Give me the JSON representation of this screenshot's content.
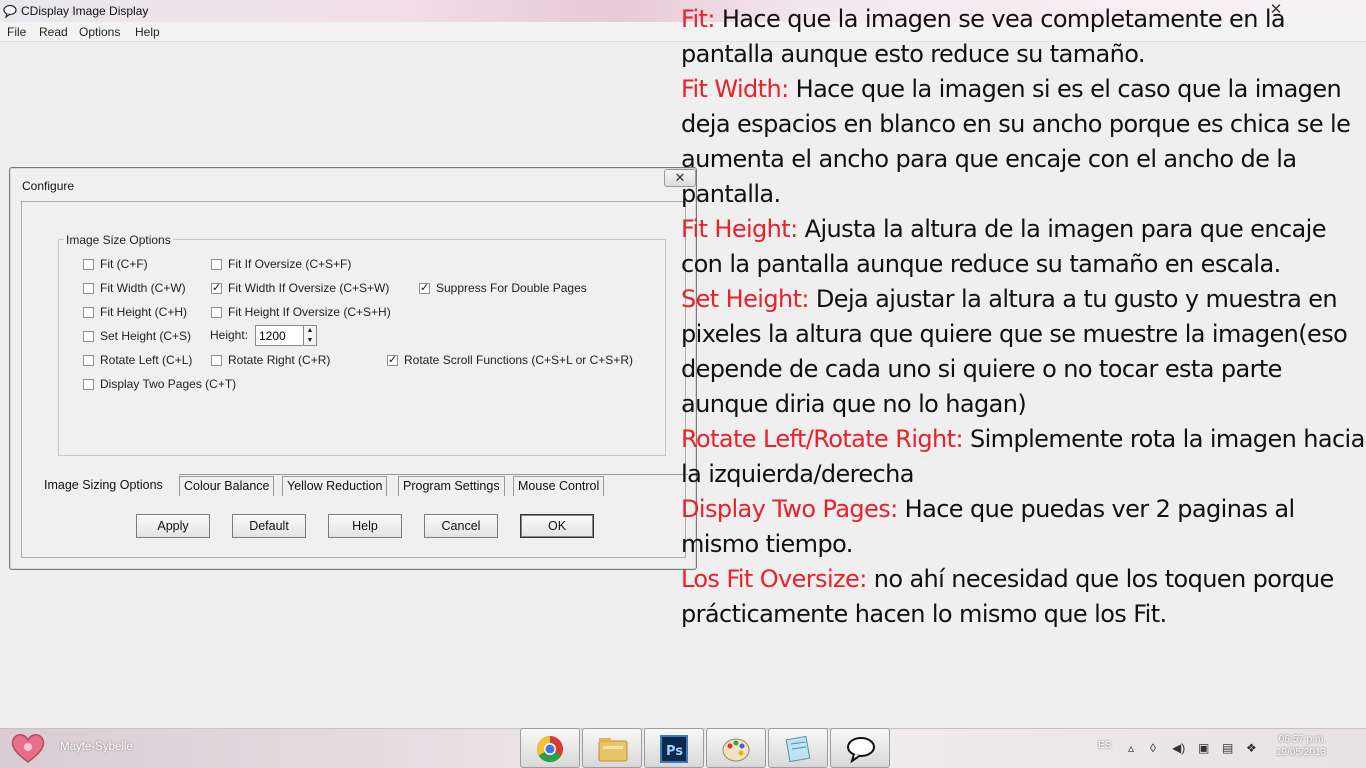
{
  "window": {
    "title": "CDisplay Image Display",
    "close_glyph": "✕",
    "menu": [
      "File",
      "Read",
      "Options",
      "Help"
    ]
  },
  "dialog": {
    "title": "Configure",
    "close_glyph": "✕",
    "group_label": "Image Size Options",
    "options": {
      "fit": {
        "label": "Fit (C+F)",
        "checked": false
      },
      "fit_if_oversize": {
        "label": "Fit If Oversize (C+S+F)",
        "checked": false
      },
      "fit_width": {
        "label": "Fit Width (C+W)",
        "checked": false
      },
      "fit_width_if_oversize": {
        "label": "Fit Width If Oversize (C+S+W)",
        "checked": true
      },
      "suppress_double": {
        "label": "Suppress For Double Pages",
        "checked": true
      },
      "fit_height": {
        "label": "Fit Height (C+H)",
        "checked": false
      },
      "fit_height_if_oversize": {
        "label": "Fit Height If Oversize (C+S+H)",
        "checked": false
      },
      "set_height": {
        "label": "Set Height (C+S)",
        "checked": false
      },
      "rotate_left": {
        "label": "Rotate Left (C+L)",
        "checked": false
      },
      "rotate_right": {
        "label": "Rotate Right (C+R)",
        "checked": false
      },
      "rotate_scroll": {
        "label": "Rotate Scroll Functions (C+S+L or C+S+R)",
        "checked": true
      },
      "two_pages": {
        "label": "Display Two Pages (C+T)",
        "checked": false
      }
    },
    "height_label": "Height:",
    "height_value": "1200",
    "tabs": [
      "Image Sizing Options",
      "Colour Balance",
      "Yellow Reduction",
      "Program Settings",
      "Mouse Control"
    ],
    "buttons": {
      "apply": "Apply",
      "default": "Default",
      "help": "Help",
      "cancel": "Cancel",
      "ok": "OK"
    }
  },
  "notes": [
    {
      "key": "Fit:",
      "text": " Hace que la imagen se vea completamente en la pantalla aunque esto reduce su tamaño."
    },
    {
      "key": "Fit Width:",
      "text": " Hace que la imagen si es el caso que la imagen deja espacios en blanco en su ancho porque es chica se le aumenta el ancho para que encaje con el ancho de la pantalla."
    },
    {
      "key": "Fit Height:",
      "text": " Ajusta la altura de la imagen para que encaje con la pantalla aunque reduce su tamaño en escala."
    },
    {
      "key": "Set Height:",
      "text": " Deja ajustar la altura a tu gusto y muestra en pixeles la altura que quiere que se muestre la imagen(eso depende de cada uno si quiere o no tocar esta parte aunque diria que no lo hagan)"
    },
    {
      "key": "Rotate Left/Rotate Right:",
      "text": " Simplemente rota la imagen hacia la izquierda/derecha"
    },
    {
      "key": "Display Two Pages:",
      "text": " Hace que puedas ver 2 paginas al mismo tiempo."
    },
    {
      "key": "Los Fit Oversize:",
      "text": " no ahí necesidad que los toquen porque prácticamente hacen lo mismo que los Fit."
    }
  ],
  "taskbar": {
    "user": "Mayte-Sybelle",
    "apps": [
      "chrome-icon",
      "folder-icon",
      "photoshop-icon",
      "paint-icon",
      "notepad-icon",
      "cdisplay-icon"
    ],
    "ps_label": "Ps",
    "lang": "ES",
    "time": "06:57 p.m.",
    "date": "19/05/2013"
  },
  "colors": {
    "note_key": "#e8212a",
    "dialog_bg": "#f0f0f0"
  }
}
